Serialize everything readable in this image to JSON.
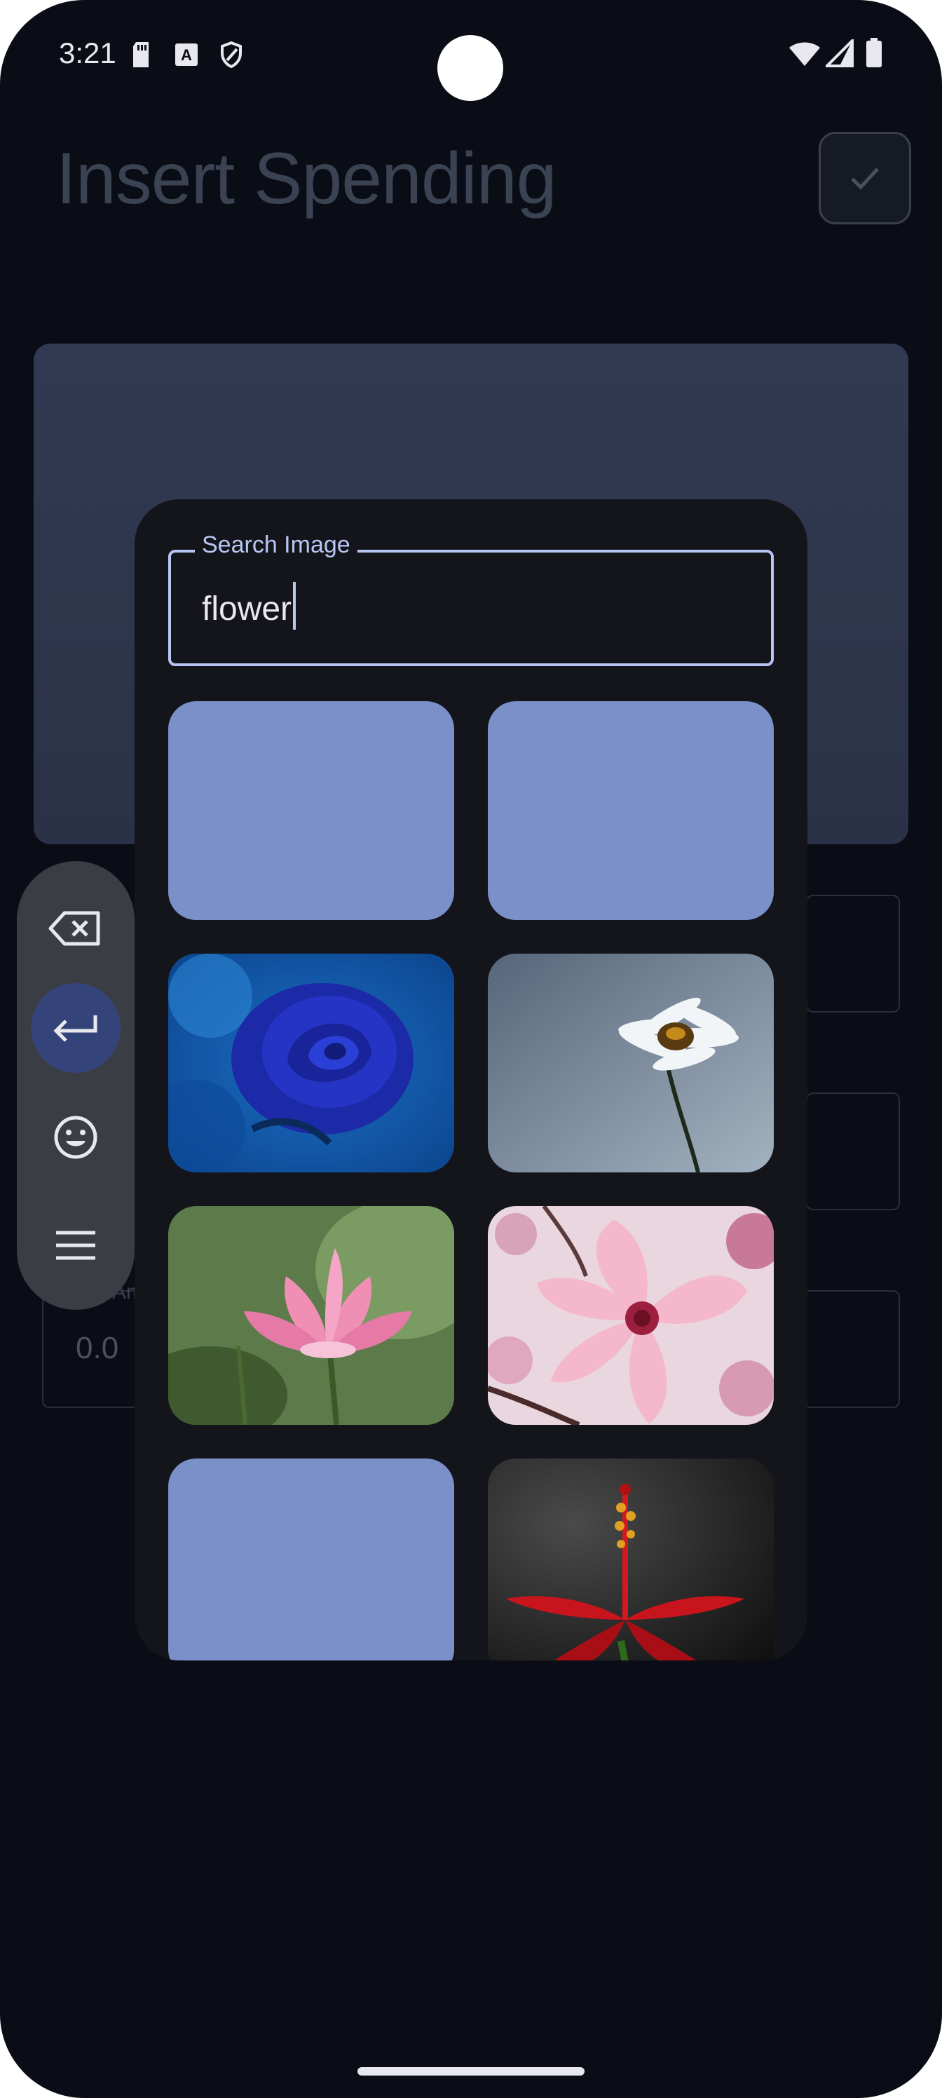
{
  "status_bar": {
    "time": "3:21",
    "left_icons": [
      "sd-card-icon",
      "keyboard-a-icon",
      "shield-icon"
    ],
    "right_icons": [
      "wifi-icon",
      "signal-icon",
      "battery-icon"
    ]
  },
  "header": {
    "title": "Insert Spending",
    "confirm_icon": "check-icon"
  },
  "form": {
    "amount_label": "Amount",
    "amount_value": "0.0"
  },
  "keyboard_toolbar": {
    "buttons": [
      "backspace-icon",
      "enter-icon",
      "emoji-icon",
      "menu-icon"
    ],
    "active": "enter-icon"
  },
  "dialog": {
    "search_label": "Search Image",
    "search_value": "flower",
    "results": [
      {
        "kind": "placeholder"
      },
      {
        "kind": "placeholder"
      },
      {
        "kind": "image",
        "subject": "blue rose"
      },
      {
        "kind": "image",
        "subject": "white daisy"
      },
      {
        "kind": "image",
        "subject": "pink lotus"
      },
      {
        "kind": "image",
        "subject": "pink blossom"
      },
      {
        "kind": "placeholder"
      },
      {
        "kind": "image",
        "subject": "red hibiscus"
      }
    ]
  },
  "colors": {
    "background": "#0b0d16",
    "dialog": "#13151b",
    "accent": "#b9c6f4",
    "placeholder_tile": "#7b8fc9",
    "keyboard_active": "#34437a"
  }
}
